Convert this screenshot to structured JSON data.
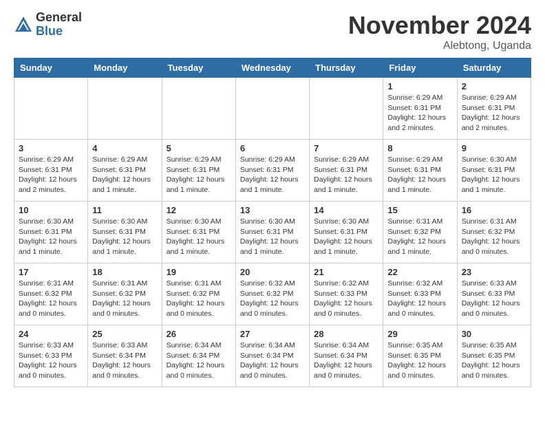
{
  "logo": {
    "general": "General",
    "blue": "Blue"
  },
  "header": {
    "month": "November 2024",
    "location": "Alebtong, Uganda"
  },
  "weekdays": [
    "Sunday",
    "Monday",
    "Tuesday",
    "Wednesday",
    "Thursday",
    "Friday",
    "Saturday"
  ],
  "weeks": [
    [
      {
        "day": "",
        "info": ""
      },
      {
        "day": "",
        "info": ""
      },
      {
        "day": "",
        "info": ""
      },
      {
        "day": "",
        "info": ""
      },
      {
        "day": "",
        "info": ""
      },
      {
        "day": "1",
        "info": "Sunrise: 6:29 AM\nSunset: 6:31 PM\nDaylight: 12 hours and 2 minutes."
      },
      {
        "day": "2",
        "info": "Sunrise: 6:29 AM\nSunset: 6:31 PM\nDaylight: 12 hours and 2 minutes."
      }
    ],
    [
      {
        "day": "3",
        "info": "Sunrise: 6:29 AM\nSunset: 6:31 PM\nDaylight: 12 hours and 2 minutes."
      },
      {
        "day": "4",
        "info": "Sunrise: 6:29 AM\nSunset: 6:31 PM\nDaylight: 12 hours and 1 minute."
      },
      {
        "day": "5",
        "info": "Sunrise: 6:29 AM\nSunset: 6:31 PM\nDaylight: 12 hours and 1 minute."
      },
      {
        "day": "6",
        "info": "Sunrise: 6:29 AM\nSunset: 6:31 PM\nDaylight: 12 hours and 1 minute."
      },
      {
        "day": "7",
        "info": "Sunrise: 6:29 AM\nSunset: 6:31 PM\nDaylight: 12 hours and 1 minute."
      },
      {
        "day": "8",
        "info": "Sunrise: 6:29 AM\nSunset: 6:31 PM\nDaylight: 12 hours and 1 minute."
      },
      {
        "day": "9",
        "info": "Sunrise: 6:30 AM\nSunset: 6:31 PM\nDaylight: 12 hours and 1 minute."
      }
    ],
    [
      {
        "day": "10",
        "info": "Sunrise: 6:30 AM\nSunset: 6:31 PM\nDaylight: 12 hours and 1 minute."
      },
      {
        "day": "11",
        "info": "Sunrise: 6:30 AM\nSunset: 6:31 PM\nDaylight: 12 hours and 1 minute."
      },
      {
        "day": "12",
        "info": "Sunrise: 6:30 AM\nSunset: 6:31 PM\nDaylight: 12 hours and 1 minute."
      },
      {
        "day": "13",
        "info": "Sunrise: 6:30 AM\nSunset: 6:31 PM\nDaylight: 12 hours and 1 minute."
      },
      {
        "day": "14",
        "info": "Sunrise: 6:30 AM\nSunset: 6:31 PM\nDaylight: 12 hours and 1 minute."
      },
      {
        "day": "15",
        "info": "Sunrise: 6:31 AM\nSunset: 6:32 PM\nDaylight: 12 hours and 1 minute."
      },
      {
        "day": "16",
        "info": "Sunrise: 6:31 AM\nSunset: 6:32 PM\nDaylight: 12 hours and 0 minutes."
      }
    ],
    [
      {
        "day": "17",
        "info": "Sunrise: 6:31 AM\nSunset: 6:32 PM\nDaylight: 12 hours and 0 minutes."
      },
      {
        "day": "18",
        "info": "Sunrise: 6:31 AM\nSunset: 6:32 PM\nDaylight: 12 hours and 0 minutes."
      },
      {
        "day": "19",
        "info": "Sunrise: 6:31 AM\nSunset: 6:32 PM\nDaylight: 12 hours and 0 minutes."
      },
      {
        "day": "20",
        "info": "Sunrise: 6:32 AM\nSunset: 6:32 PM\nDaylight: 12 hours and 0 minutes."
      },
      {
        "day": "21",
        "info": "Sunrise: 6:32 AM\nSunset: 6:33 PM\nDaylight: 12 hours and 0 minutes."
      },
      {
        "day": "22",
        "info": "Sunrise: 6:32 AM\nSunset: 6:33 PM\nDaylight: 12 hours and 0 minutes."
      },
      {
        "day": "23",
        "info": "Sunrise: 6:33 AM\nSunset: 6:33 PM\nDaylight: 12 hours and 0 minutes."
      }
    ],
    [
      {
        "day": "24",
        "info": "Sunrise: 6:33 AM\nSunset: 6:33 PM\nDaylight: 12 hours and 0 minutes."
      },
      {
        "day": "25",
        "info": "Sunrise: 6:33 AM\nSunset: 6:34 PM\nDaylight: 12 hours and 0 minutes."
      },
      {
        "day": "26",
        "info": "Sunrise: 6:34 AM\nSunset: 6:34 PM\nDaylight: 12 hours and 0 minutes."
      },
      {
        "day": "27",
        "info": "Sunrise: 6:34 AM\nSunset: 6:34 PM\nDaylight: 12 hours and 0 minutes."
      },
      {
        "day": "28",
        "info": "Sunrise: 6:34 AM\nSunset: 6:34 PM\nDaylight: 12 hours and 0 minutes."
      },
      {
        "day": "29",
        "info": "Sunrise: 6:35 AM\nSunset: 6:35 PM\nDaylight: 12 hours and 0 minutes."
      },
      {
        "day": "30",
        "info": "Sunrise: 6:35 AM\nSunset: 6:35 PM\nDaylight: 12 hours and 0 minutes."
      }
    ]
  ]
}
